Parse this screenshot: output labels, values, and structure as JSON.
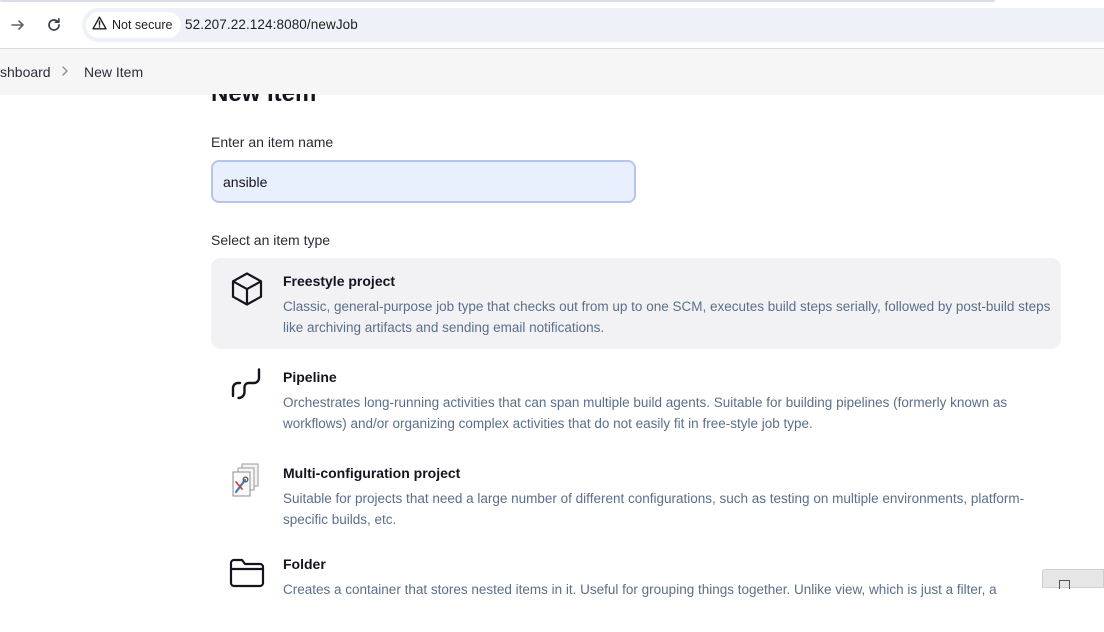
{
  "browser": {
    "security_label": "Not secure",
    "url": "52.207.22.124:8080/newJob"
  },
  "breadcrumb": {
    "dashboard": "shboard",
    "separator": ">",
    "current": "New Item"
  },
  "page": {
    "heading": "New Item",
    "name_label": "Enter an item name",
    "name_value": "ansible",
    "type_label": "Select an item type"
  },
  "item_types": [
    {
      "title": "Freestyle project",
      "description": "Classic, general-purpose job type that checks out from up to one SCM, executes build steps serially, followed by post-build steps like archiving artifacts and sending email notifications.",
      "icon": "freestyle-cube-icon",
      "selected": true
    },
    {
      "title": "Pipeline",
      "description": "Orchestrates long-running activities that can span multiple build agents. Suitable for building pipelines (formerly known as workflows) and/or organizing complex activities that do not easily fit in free-style job type.",
      "icon": "pipeline-icon",
      "selected": false
    },
    {
      "title": "Multi-configuration project",
      "description": "Suitable for projects that need a large number of different configurations, such as testing on multiple environments, platform-specific builds, etc.",
      "icon": "multi-config-icon",
      "selected": false
    },
    {
      "title": "Folder",
      "description": "Creates a container that stores nested items in it. Useful for grouping things together. Unlike view, which is just a filter, a",
      "icon": "folder-icon",
      "selected": false
    }
  ],
  "colors": {
    "selected_bg": "#f2f2f5",
    "description_text": "#5a6f8c",
    "input_bg": "#e8f0fe",
    "input_border": "#b7c4ec"
  }
}
